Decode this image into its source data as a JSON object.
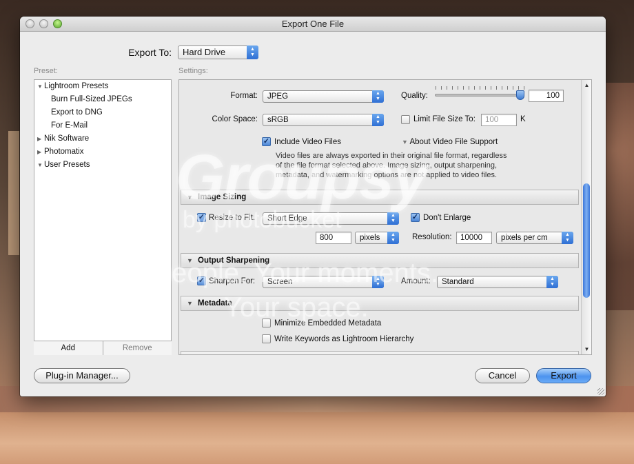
{
  "window": {
    "title": "Export One File"
  },
  "export_to": {
    "label": "Export To:",
    "value": "Hard Drive"
  },
  "preset": {
    "label": "Preset:",
    "tree": [
      {
        "label": "Lightroom Presets",
        "expanded": true
      },
      {
        "label": "Burn Full-Sized JPEGs"
      },
      {
        "label": "Export to DNG"
      },
      {
        "label": "For E-Mail"
      },
      {
        "label": "Nik Software",
        "expanded": false
      },
      {
        "label": "Photomatix",
        "expanded": false
      },
      {
        "label": "User Presets",
        "expanded": true
      }
    ],
    "add_label": "Add",
    "remove_label": "Remove"
  },
  "settings": {
    "label": "Settings:",
    "format_label": "Format:",
    "format_value": "JPEG",
    "quality_label": "Quality:",
    "quality_value": "100",
    "color_space_label": "Color Space:",
    "color_space_value": "sRGB",
    "limit_file_size_label": "Limit File Size To:",
    "limit_file_size_value": "100",
    "limit_file_size_unit": "K",
    "include_video_label": "Include Video Files",
    "about_video_label": "About Video File Support",
    "video_note_1": "Video files are always exported in their original file format, regardless",
    "video_note_2": "of the file format selected above. Image sizing, output sharpening,",
    "video_note_3": "metadata, and watermarking options are not applied to video files.",
    "image_sizing": {
      "title": "Image Sizing",
      "resize_label": "Resize to Fit:",
      "resize_value": "Short Edge",
      "dont_enlarge_label": "Don't Enlarge",
      "size_value": "800",
      "size_unit": "pixels",
      "resolution_label": "Resolution:",
      "resolution_value": "10000",
      "resolution_unit": "pixels per cm"
    },
    "output_sharpening": {
      "title": "Output Sharpening",
      "sharpen_label": "Sharpen For:",
      "sharpen_value": "Screen",
      "amount_label": "Amount:",
      "amount_value": "Standard"
    },
    "metadata": {
      "title": "Metadata",
      "minimize_label": "Minimize Embedded Metadata",
      "keywords_label": "Write Keywords as Lightroom Hierarchy"
    }
  },
  "buttons": {
    "plugin_manager": "Plug-in Manager...",
    "cancel": "Cancel",
    "export": "Export"
  },
  "watermark": {
    "logo": "Groupsy",
    "by": "by photobucket",
    "line1": "Your people. Your moments.",
    "line2": "Your space."
  },
  "colors": {
    "accent": "#4c93ee",
    "window_bg": "#ececec"
  }
}
